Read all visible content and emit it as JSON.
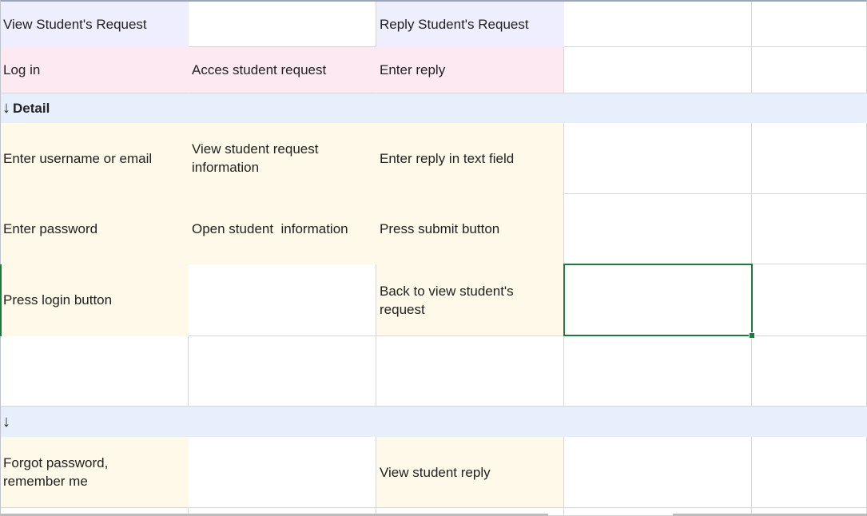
{
  "rows": [
    {
      "cells": [
        "View Student's Request",
        "",
        "Reply Student's Request",
        "",
        ""
      ]
    },
    {
      "cells": [
        "Log in",
        "Acces student request",
        "Enter reply",
        "",
        ""
      ]
    },
    {
      "band": "Detail",
      "arrow": "↓"
    },
    {
      "cells": [
        "Enter username or email",
        "View student request information",
        "Enter reply in text field",
        "",
        ""
      ]
    },
    {
      "cells": [
        "Enter password",
        "Open student  information",
        "Press submit button",
        "",
        ""
      ]
    },
    {
      "cells": [
        "Press login button",
        "",
        "Back to view student's request",
        "",
        ""
      ]
    },
    {
      "cells": [
        "",
        "",
        "",
        "",
        ""
      ]
    },
    {
      "band": "",
      "arrow": "↓"
    },
    {
      "cells": [
        "Forgot password, remember me",
        "",
        "View student reply",
        "",
        ""
      ]
    }
  ],
  "colors": {
    "header_cards": "#efeefe",
    "activity_cards": "#fde9f2",
    "task_cards": "#fef9e8",
    "band": "#e7effd",
    "selection": "#1e7a3e"
  }
}
